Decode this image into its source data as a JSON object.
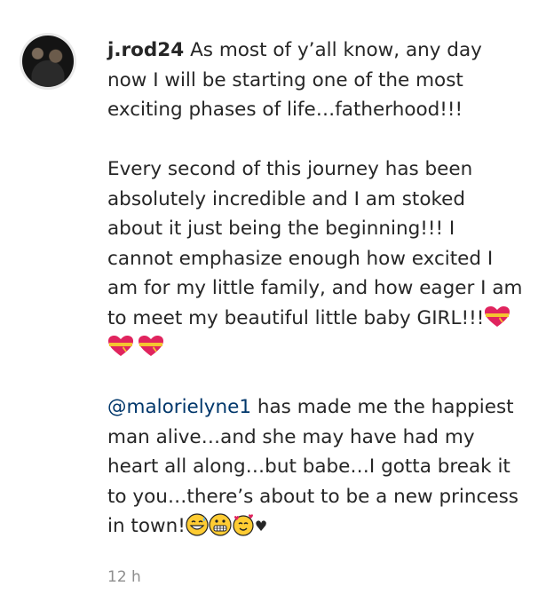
{
  "comment": {
    "username": "j.rod24",
    "paragraph1": "As most of y’all know, any day now I will be starting one of the most exciting phases of life…fatherhood!!!",
    "paragraph2": "Every second of this journey has been absolutely incredible and I am stoked about it just being the beginning!!! I cannot emphasize enough how excited I am for my little family, and how eager I am to meet my beautiful little baby GIRL!!!",
    "mention": "@malorielyne1",
    "paragraph3": " has made me the happiest man alive…and she may have had my heart all along…but babe…I gotta break it to you…there’s about to be a new princess in town!",
    "timestamp": "12 h",
    "heart_char": "♥"
  },
  "icons": {
    "paragraph2_end": [
      "heart-with-ribbon-icon",
      "heart-with-ribbon-icon",
      "heart-with-ribbon-icon"
    ],
    "paragraph3_end": [
      "grinning-sweat-emoji",
      "grimacing-emoji",
      "smiling-hearts-emoji",
      "black-heart-icon"
    ]
  },
  "colors": {
    "text": "#262626",
    "mention": "#00376b",
    "timestamp": "#8e8e8e",
    "heart_red": "#e0245e",
    "ribbon_gold": "#f4c430",
    "emoji_yellow": "#ffcc33"
  }
}
